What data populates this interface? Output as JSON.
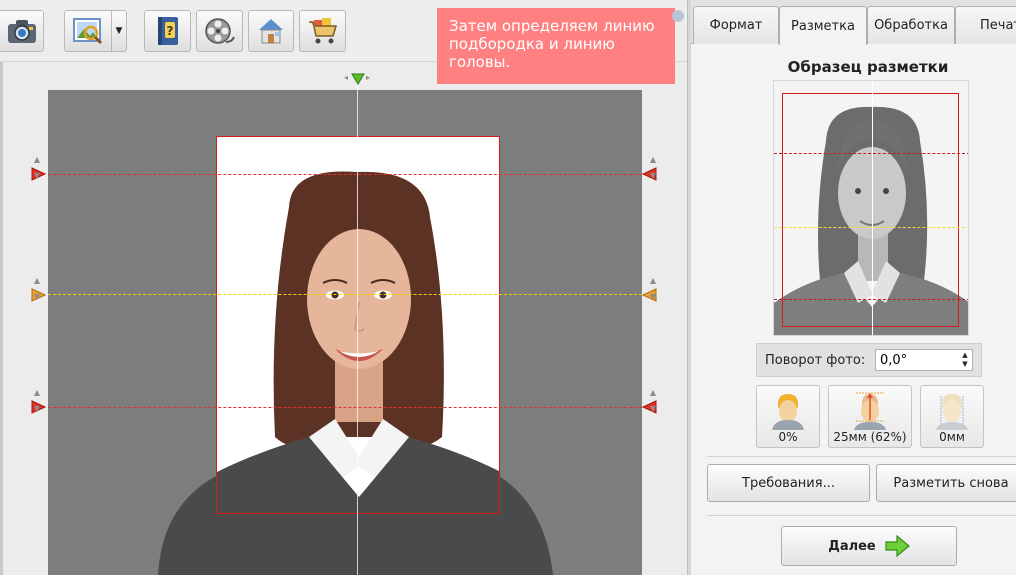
{
  "hint": {
    "text": "Затем определяем линию подбородка и линию головы."
  },
  "tabs": [
    {
      "label": "Формат"
    },
    {
      "label": "Разметка"
    },
    {
      "label": "Обработка"
    },
    {
      "label": "Печать"
    }
  ],
  "panel": {
    "sample_title": "Образец разметки",
    "rotation_label": "Поворот фото:",
    "rotation_value": "0,0°",
    "measure_buttons": [
      {
        "label": "0%"
      },
      {
        "label": "25мм (62%)"
      },
      {
        "label": "0мм"
      }
    ],
    "requirements_button": "Требования...",
    "remark_button": "Разметить снова",
    "next_button": "Далее"
  },
  "colors": {
    "hint_background": "#ff8080",
    "guide_red": "#e03030",
    "guide_yellow": "#f0d000",
    "canvas_gray": "#7d7d7d"
  },
  "icons": {
    "toolbar": [
      "camera-icon",
      "zoom-image-icon",
      "help-book-icon",
      "video-film-icon",
      "home-icon",
      "shopping-cart-icon"
    ],
    "next_button": "green-arrow-right-icon"
  }
}
